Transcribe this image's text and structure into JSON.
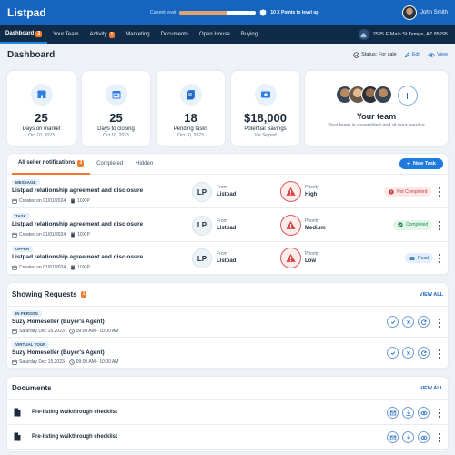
{
  "app": {
    "name": "Listpad"
  },
  "level": {
    "label": "Current level",
    "progress": 0.62,
    "points_text": "10 X Points to level up"
  },
  "user": {
    "name": "John Smith"
  },
  "nav": {
    "items": [
      {
        "label": "Dashboard",
        "badge": "3",
        "active": true
      },
      {
        "label": "Your Team"
      },
      {
        "label": "Activity",
        "badge": "1"
      },
      {
        "label": "Marketing"
      },
      {
        "label": "Documents"
      },
      {
        "label": "Open House"
      },
      {
        "label": "Buying"
      }
    ],
    "address": "2525 E Main St Tempe, AZ 85295"
  },
  "page": {
    "title": "Dashboard",
    "status": "Status: For sale",
    "edit": "Edit",
    "view": "View"
  },
  "stats": [
    {
      "value": "25",
      "label": "Days on market",
      "sub": "Oct 10, 2023",
      "icon": "store-icon"
    },
    {
      "value": "25",
      "label": "Days to closing",
      "sub": "Oct 10, 2023",
      "icon": "calendar-icon"
    },
    {
      "value": "18",
      "label": "Pending tasks",
      "sub": "Oct 10, 2023",
      "icon": "documents-icon"
    },
    {
      "value": "$18,000",
      "label": "Potential Savings",
      "sub": "Via Selpad",
      "icon": "savings-icon"
    }
  ],
  "team": {
    "title": "Your team",
    "subtitle": "Your team is assembled and at your service"
  },
  "notifications": {
    "tabs": [
      {
        "label": "All seller notifications",
        "badge": "3"
      },
      {
        "label": "Completed"
      },
      {
        "label": "Hidden"
      }
    ],
    "new_task": "New Task",
    "rows": [
      {
        "tag": "MESSAGE",
        "title": "Listpad relationship agreement and disclosure",
        "created": "Created on 01/01/2024",
        "owner": "10X P",
        "initials": "LP",
        "from_label": "From",
        "from": "Listpad",
        "priority_label": "Priority",
        "priority": "High",
        "status": "Not Completed"
      },
      {
        "tag": "TASK",
        "title": "Listpad relationship agreement and disclosure",
        "created": "Created on 01/01/2024",
        "owner": "10X P",
        "initials": "LP",
        "from_label": "From",
        "from": "Listpad",
        "priority_label": "Priority",
        "priority": "Medium",
        "status": "Completed"
      },
      {
        "tag": "OFFER",
        "title": "Listpad relationship agreement and disclosure",
        "created": "Created on 01/01/2024",
        "owner": "10X P",
        "initials": "LP",
        "from_label": "From",
        "from": "Listpad",
        "priority_label": "Priority",
        "priority": "Low",
        "status": "Read"
      }
    ]
  },
  "showing": {
    "title": "Showing Requests",
    "badge": "1",
    "view_all": "VIEW ALL",
    "rows": [
      {
        "tag": "IN PERSON",
        "title": "Suzy Homeseller (Buyer's Agent)",
        "date": "Saturday Dec 15,2023",
        "time": "09:00 AM - 10:00 AM"
      },
      {
        "tag": "VIRTUAL TOUR",
        "title": "Suzy Homeseller (Buyer's Agent)",
        "date": "Saturday Dec 15,2023",
        "time": "09:00 AM - 10:00 AM"
      }
    ]
  },
  "documents": {
    "title": "Documents",
    "view_all": "VIEW ALL",
    "rows": [
      {
        "title": "Pre-listing walkthrough checklist"
      },
      {
        "title": "Pre-listing walkthrough checklist"
      }
    ]
  },
  "colors": {
    "brand": "#1565c0",
    "nav": "#0f2b47",
    "accent": "#f07a2a"
  }
}
